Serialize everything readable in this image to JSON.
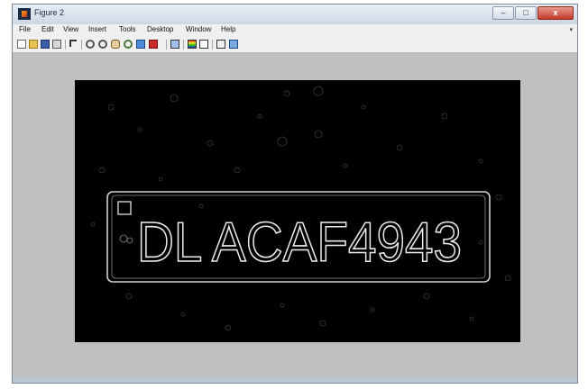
{
  "window": {
    "title": "Figure 2",
    "controls": {
      "minimize": "–",
      "maximize": "□",
      "close": "x"
    }
  },
  "menubar": {
    "items": [
      "File",
      "Edit",
      "View",
      "Insert",
      "Tools",
      "Desktop",
      "Window",
      "Help"
    ]
  },
  "toolbar": {
    "icons": [
      "new-figure-icon",
      "open-file-icon",
      "save-icon",
      "print-icon",
      "edit-plot-icon",
      "zoom-in-icon",
      "zoom-out-icon",
      "pan-icon",
      "rotate-3d-icon",
      "data-cursor-icon",
      "brush-icon",
      "link-plot-icon",
      "insert-colorbar-icon",
      "insert-legend-icon",
      "hide-plot-tools-icon",
      "show-plot-tools-icon"
    ]
  },
  "figure": {
    "plate_text": "DL ACAF4943"
  }
}
